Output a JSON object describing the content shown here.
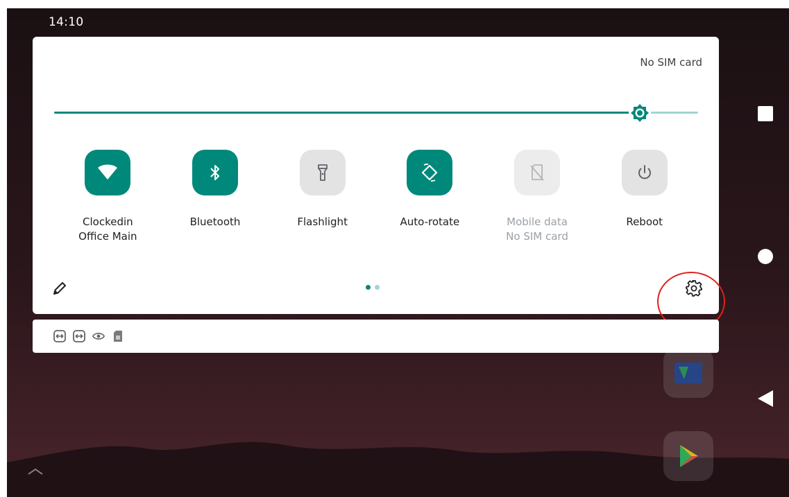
{
  "status_bar": {
    "time": "14:10"
  },
  "quick_settings": {
    "carrier_text": "No SIM card",
    "brightness": {
      "level_percent": 91
    },
    "tiles": [
      {
        "id": "wifi",
        "label": "Clockedin",
        "sublabel": "Office Main",
        "state": "on",
        "icon": "wifi-icon"
      },
      {
        "id": "bluetooth",
        "label": "Bluetooth",
        "sublabel": "",
        "state": "on",
        "icon": "bluetooth-icon"
      },
      {
        "id": "flashlight",
        "label": "Flashlight",
        "sublabel": "",
        "state": "off",
        "icon": "flashlight-icon"
      },
      {
        "id": "autorotate",
        "label": "Auto-rotate",
        "sublabel": "",
        "state": "on",
        "icon": "autorotate-icon"
      },
      {
        "id": "mobiledata",
        "label": "Mobile data",
        "sublabel": "No SIM card",
        "state": "disabled",
        "icon": "no-sim-icon"
      },
      {
        "id": "reboot",
        "label": "Reboot",
        "sublabel": "",
        "state": "off",
        "icon": "power-icon"
      }
    ],
    "page_indicator": {
      "current": 1,
      "total": 2
    }
  },
  "notification_icons": [
    "teamviewer-icon",
    "teamviewer-icon",
    "eye-icon",
    "sim-card-icon"
  ],
  "navigation": {
    "buttons": [
      "recents-button",
      "home-button",
      "back-button"
    ]
  },
  "colors": {
    "accent": "#00897b",
    "accent_light": "#9fd6cf",
    "tile_off": "#e3e3e3",
    "highlight": "#e0201b"
  }
}
